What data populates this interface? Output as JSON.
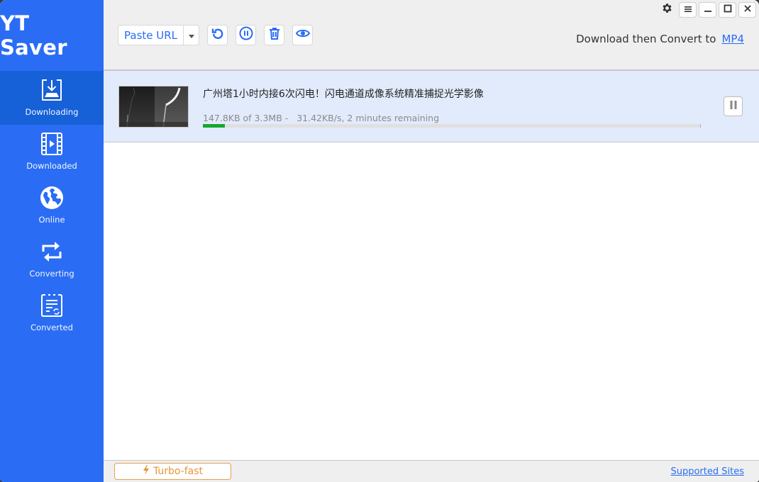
{
  "app": {
    "title": "YT Saver"
  },
  "colors": {
    "brand": "#2a6df4",
    "sidebar_active": "#1660d8",
    "row_highlight": "#e2ebfc",
    "progress": "#16a82e",
    "turbo": "#e8953a"
  },
  "sidebar": {
    "items": [
      {
        "label": "Downloading",
        "icon": "download-icon",
        "active": true
      },
      {
        "label": "Downloaded",
        "icon": "film-icon",
        "active": false
      },
      {
        "label": "Online",
        "icon": "globe-icon",
        "active": false
      },
      {
        "label": "Converting",
        "icon": "convert-arrows-icon",
        "active": false
      },
      {
        "label": "Converted",
        "icon": "converted-doc-icon",
        "active": false
      }
    ]
  },
  "toolbar": {
    "paste_url_label": "Paste URL",
    "buttons": [
      {
        "name": "refresh",
        "icon": "refresh-icon"
      },
      {
        "name": "pause-all",
        "icon": "pause-circle-icon"
      },
      {
        "name": "delete",
        "icon": "trash-icon"
      },
      {
        "name": "preview",
        "icon": "eye-icon"
      }
    ],
    "convert_label": "Download then Convert to",
    "convert_format": "MP4"
  },
  "window_controls": {
    "settings": "gear-icon",
    "menu": "menu-icon",
    "minimize": "minimize-icon",
    "maximize": "maximize-icon",
    "close": "close-icon"
  },
  "downloads": [
    {
      "title": "广州塔1小时内接6次闪电！闪电通道成像系统精准捕捉光学影像",
      "downloaded": "147.8KB",
      "total": "3.3MB",
      "status": "147.8KB of 3.3MB -   31.42KB/s, 2 minutes remaining",
      "speed": "31.42KB/s",
      "remaining": "2 minutes remaining",
      "progress_percent": 4.4
    }
  ],
  "footer": {
    "turbo_label": "Turbo-fast",
    "supported_sites_label": "Supported Sites"
  }
}
